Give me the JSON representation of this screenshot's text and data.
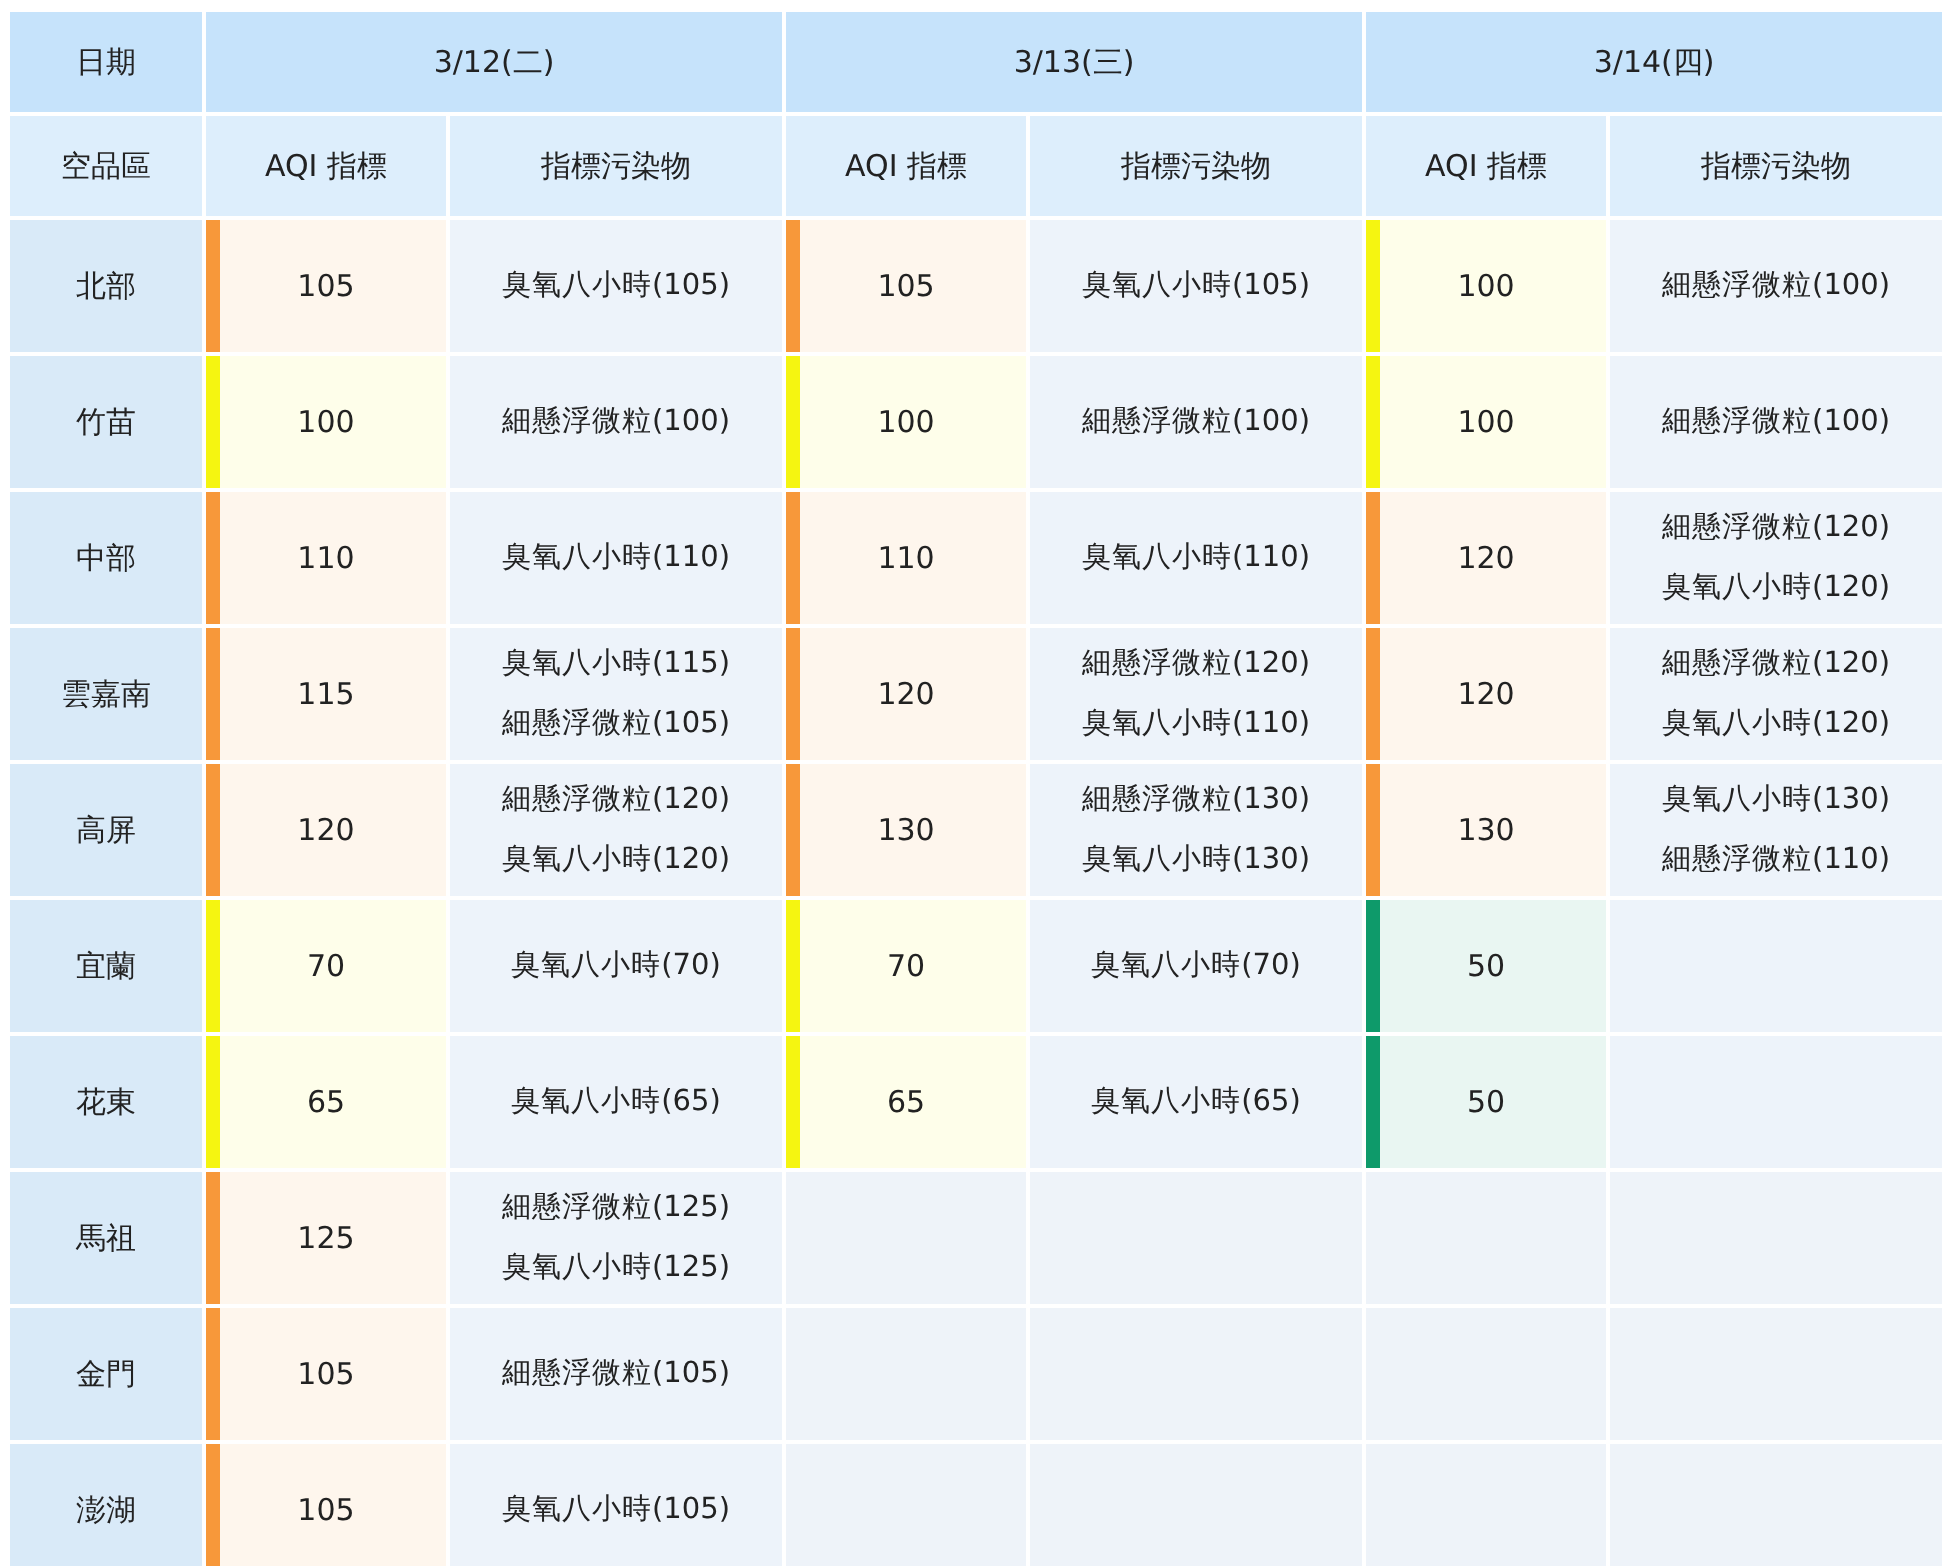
{
  "header": {
    "date_label": "日期",
    "region_label": "空品區",
    "dates": [
      {
        "date": "3/12(二)",
        "aqi_label": "AQI 指標",
        "pollutant_label": "指標污染物"
      },
      {
        "date": "3/13(三)",
        "aqi_label": "AQI 指標",
        "pollutant_label": "指標污染物"
      },
      {
        "date": "3/14(四)",
        "aqi_label": "AQI 指標",
        "pollutant_label": "指標污染物"
      }
    ]
  },
  "rows": [
    {
      "region": "北部",
      "days": [
        {
          "aqi": "105",
          "color": "#f7983a",
          "pollutants": [
            "臭氧八小時(105)"
          ]
        },
        {
          "aqi": "105",
          "color": "#f7983a",
          "pollutants": [
            "臭氧八小時(105)"
          ]
        },
        {
          "aqi": "100",
          "color": "#f5f511",
          "pollutants": [
            "細懸浮微粒(100)"
          ]
        }
      ]
    },
    {
      "region": "竹苗",
      "days": [
        {
          "aqi": "100",
          "color": "#f5f511",
          "pollutants": [
            "細懸浮微粒(100)"
          ]
        },
        {
          "aqi": "100",
          "color": "#f5f511",
          "pollutants": [
            "細懸浮微粒(100)"
          ]
        },
        {
          "aqi": "100",
          "color": "#f5f511",
          "pollutants": [
            "細懸浮微粒(100)"
          ]
        }
      ]
    },
    {
      "region": "中部",
      "days": [
        {
          "aqi": "110",
          "color": "#f7983a",
          "pollutants": [
            "臭氧八小時(110)"
          ]
        },
        {
          "aqi": "110",
          "color": "#f7983a",
          "pollutants": [
            "臭氧八小時(110)"
          ]
        },
        {
          "aqi": "120",
          "color": "#f7983a",
          "pollutants": [
            "細懸浮微粒(120)",
            "臭氧八小時(120)"
          ]
        }
      ]
    },
    {
      "region": "雲嘉南",
      "days": [
        {
          "aqi": "115",
          "color": "#f7983a",
          "pollutants": [
            "臭氧八小時(115)",
            "細懸浮微粒(105)"
          ]
        },
        {
          "aqi": "120",
          "color": "#f7983a",
          "pollutants": [
            "細懸浮微粒(120)",
            "臭氧八小時(110)"
          ]
        },
        {
          "aqi": "120",
          "color": "#f7983a",
          "pollutants": [
            "細懸浮微粒(120)",
            "臭氧八小時(120)"
          ]
        }
      ]
    },
    {
      "region": "高屏",
      "days": [
        {
          "aqi": "120",
          "color": "#f7983a",
          "pollutants": [
            "細懸浮微粒(120)",
            "臭氧八小時(120)"
          ]
        },
        {
          "aqi": "130",
          "color": "#f7983a",
          "pollutants": [
            "細懸浮微粒(130)",
            "臭氧八小時(130)"
          ]
        },
        {
          "aqi": "130",
          "color": "#f7983a",
          "pollutants": [
            "臭氧八小時(130)",
            "細懸浮微粒(110)"
          ]
        }
      ]
    },
    {
      "region": "宜蘭",
      "days": [
        {
          "aqi": "70",
          "color": "#f5f511",
          "pollutants": [
            "臭氧八小時(70)"
          ]
        },
        {
          "aqi": "70",
          "color": "#f5f511",
          "pollutants": [
            "臭氧八小時(70)"
          ]
        },
        {
          "aqi": "50",
          "color": "#0e9a6a"
        }
      ]
    },
    {
      "region": "花東",
      "days": [
        {
          "aqi": "65",
          "color": "#f5f511",
          "pollutants": [
            "臭氧八小時(65)"
          ]
        },
        {
          "aqi": "65",
          "color": "#f5f511",
          "pollutants": [
            "臭氧八小時(65)"
          ]
        },
        {
          "aqi": "50",
          "color": "#0e9a6a"
        }
      ]
    },
    {
      "region": "馬祖",
      "days": [
        {
          "aqi": "125",
          "color": "#f7983a",
          "pollutants": [
            "細懸浮微粒(125)",
            "臭氧八小時(125)"
          ]
        }
      ]
    },
    {
      "region": "金門",
      "days": [
        {
          "aqi": "105",
          "color": "#f7983a",
          "pollutants": [
            "細懸浮微粒(105)"
          ]
        }
      ]
    },
    {
      "region": "澎湖",
      "days": [
        {
          "aqi": "105",
          "color": "#f7983a",
          "pollutants": [
            "臭氧八小時(105)"
          ]
        }
      ]
    }
  ]
}
